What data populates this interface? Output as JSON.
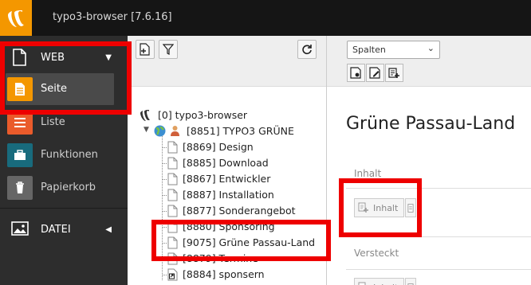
{
  "topbar": {
    "title": "typo3-browser [7.6.16]",
    "logo_icon": "typo3-logo-icon",
    "accent": "#f49700"
  },
  "module_menu": {
    "web_group": {
      "label": "WEB",
      "icon": "page-icon",
      "expanded": true
    },
    "web_items": [
      {
        "label": "Seite",
        "icon": "page-module-icon",
        "color": "#f49700",
        "active": true
      },
      {
        "label": "Liste",
        "icon": "list-module-icon",
        "color": "#ea5b2b"
      },
      {
        "label": "Funktionen",
        "icon": "functions-module-icon",
        "color": "#186b7d"
      },
      {
        "label": "Papierkorb",
        "icon": "recycler-icon",
        "color": "#666666"
      }
    ],
    "file_group": {
      "label": "DATEI",
      "icon": "image-icon",
      "expanded": false
    }
  },
  "nav_toolbar": {
    "new_page_icon": "new-page-icon",
    "filter_icon": "filter-icon",
    "refresh_icon": "refresh-icon"
  },
  "page_tree": {
    "root": "[0] typo3-browser",
    "site": "[8851] TYPO3 GRÜNE",
    "pages": [
      "[8869] Design",
      "[8885] Download",
      "[8867] Entwickler",
      "[8887] Installation",
      "[8877] Sonderangebot",
      "[8880] Sponsoring",
      "[9075] Grüne Passau-Land",
      "[8879] Termine",
      "[8884] sponsern"
    ]
  },
  "content": {
    "view_select": "Spalten",
    "page_title": "Grüne Passau-Land",
    "col_inhalt": "Inhalt",
    "col_versteckt": "Versteckt",
    "new_content_label": "Inhalt"
  },
  "highlight_color": "#ee0000"
}
